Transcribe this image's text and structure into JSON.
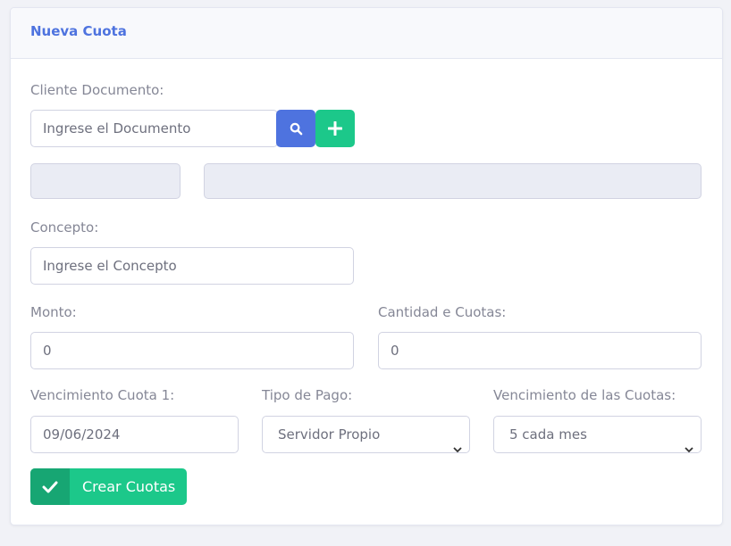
{
  "card": {
    "title": "Nueva Cuota"
  },
  "form": {
    "client_document": {
      "label": "Cliente Documento:",
      "placeholder": "Ingrese el Documento"
    },
    "client_info": {
      "field1_value": "",
      "field2_value": ""
    },
    "concept": {
      "label": "Concepto:",
      "placeholder": "Ingrese el Concepto"
    },
    "amount": {
      "label": "Monto:",
      "value": "0"
    },
    "installments_count": {
      "label": "Cantidad e Cuotas:",
      "value": "0"
    },
    "first_due_date": {
      "label": "Vencimiento Cuota 1:",
      "value": "09/06/2024"
    },
    "payment_type": {
      "label": "Tipo de Pago:",
      "selected": "Servidor Propio"
    },
    "installments_due": {
      "label": "Vencimiento de las Cuotas:",
      "selected": "5 cada mes"
    },
    "submit_label": "Crear Cuotas"
  },
  "icons": {
    "search": "search-icon",
    "add": "plus-icon",
    "dropdown": "chevron-down-icon",
    "submit": "check-icon"
  },
  "colors": {
    "primary": "#4e73df",
    "success": "#1cc88a",
    "success_dark": "#17a673",
    "readonly_bg": "#eaecf4"
  }
}
